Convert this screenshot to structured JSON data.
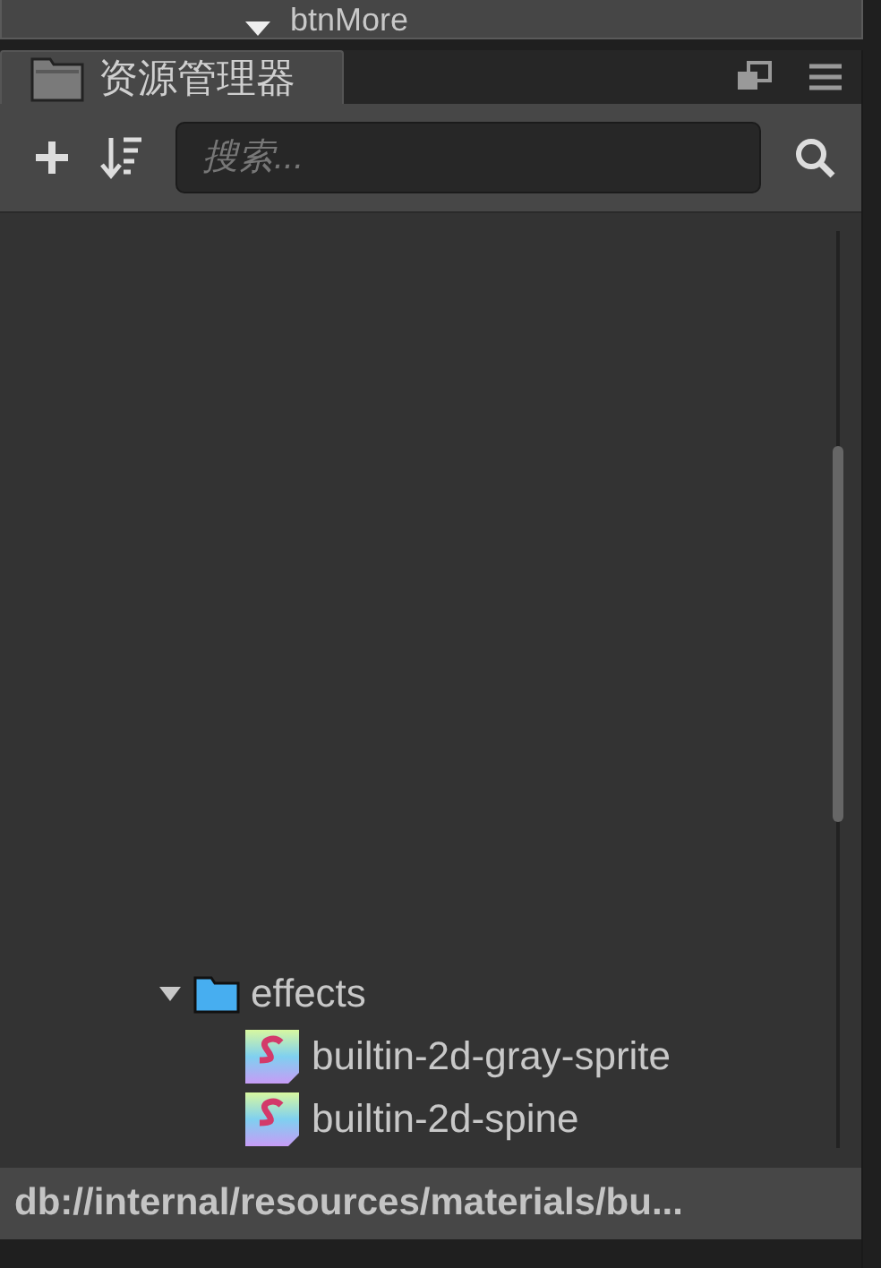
{
  "top_panel": {
    "node": {
      "label": "btnMore",
      "expanded": true
    }
  },
  "tab": {
    "title": "资源管理器",
    "selected": true
  },
  "toolbar": {
    "search": {
      "placeholder": "搜索..."
    }
  },
  "tree": [
    {
      "label": "effects",
      "kind": "folder",
      "expanded": true,
      "children": [
        {
          "label": "builtin-2d-gray-sprite",
          "kind": "shader"
        },
        {
          "label": "builtin-2d-spine",
          "kind": "shader"
        }
      ]
    }
  ],
  "status_bar": "db://internal/resources/materials/bu..."
}
